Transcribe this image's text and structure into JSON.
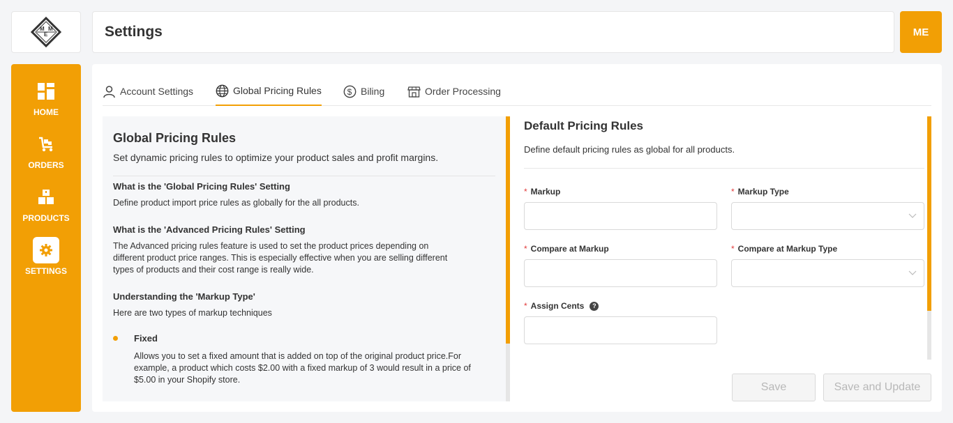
{
  "header": {
    "title": "Settings",
    "avatar_initials": "ME"
  },
  "logo": {
    "letters": "MEM"
  },
  "sidebar": {
    "items": [
      {
        "label": "HOME",
        "icon": "dashboard-icon"
      },
      {
        "label": "ORDERS",
        "icon": "cart-icon"
      },
      {
        "label": "PRODUCTS",
        "icon": "boxes-icon"
      },
      {
        "label": "SETTINGS",
        "icon": "gear-icon",
        "active": true
      }
    ]
  },
  "tabs": [
    {
      "label": "Account Settings",
      "icon": "user-icon"
    },
    {
      "label": "Global Pricing Rules",
      "icon": "globe-icon",
      "active": true
    },
    {
      "label": "Biling",
      "icon": "dollar-icon"
    },
    {
      "label": "Order Processing",
      "icon": "store-icon"
    }
  ],
  "info": {
    "title": "Global Pricing Rules",
    "subtitle": "Set dynamic pricing rules to optimize your product sales and profit margins.",
    "sections": [
      {
        "heading": "What is the 'Global Pricing Rules' Setting",
        "body": [
          "Define product import price rules as globally for the all products."
        ]
      },
      {
        "heading": "What is the 'Advanced Pricing Rules' Setting",
        "body": [
          "The Advanced pricing rules feature is used to set the product prices depending on",
          "different product price ranges. This is especially effective when you are selling different",
          "types of products and their cost range is really wide."
        ]
      },
      {
        "heading": "Understanding the 'Markup Type'",
        "body": [
          "Here are two types of markup techniques"
        ]
      }
    ],
    "fixed": {
      "heading": "Fixed",
      "body": [
        "Allows you to set a fixed amount that is added on top of the original product price.For",
        "example, a product which costs $2.00 with a fixed markup of 3 would result in a price of",
        "$5.00 in your Shopify store."
      ]
    }
  },
  "form": {
    "title": "Default Pricing Rules",
    "description": "Define default pricing rules as global for all products.",
    "required_mark": "*",
    "fields": {
      "markup": {
        "label": "Markup",
        "value": ""
      },
      "markup_type": {
        "label": "Markup Type",
        "value": ""
      },
      "compare_markup": {
        "label": "Compare at Markup",
        "value": ""
      },
      "compare_markup_type": {
        "label": "Compare at Markup Type",
        "value": ""
      },
      "assign_cents": {
        "label": "Assign Cents",
        "value": "",
        "help": "?"
      }
    },
    "save_label": "Save",
    "save_update_label": "Save and Update"
  },
  "colors": {
    "accent": "#f29f05",
    "required": "#e23c3c"
  }
}
